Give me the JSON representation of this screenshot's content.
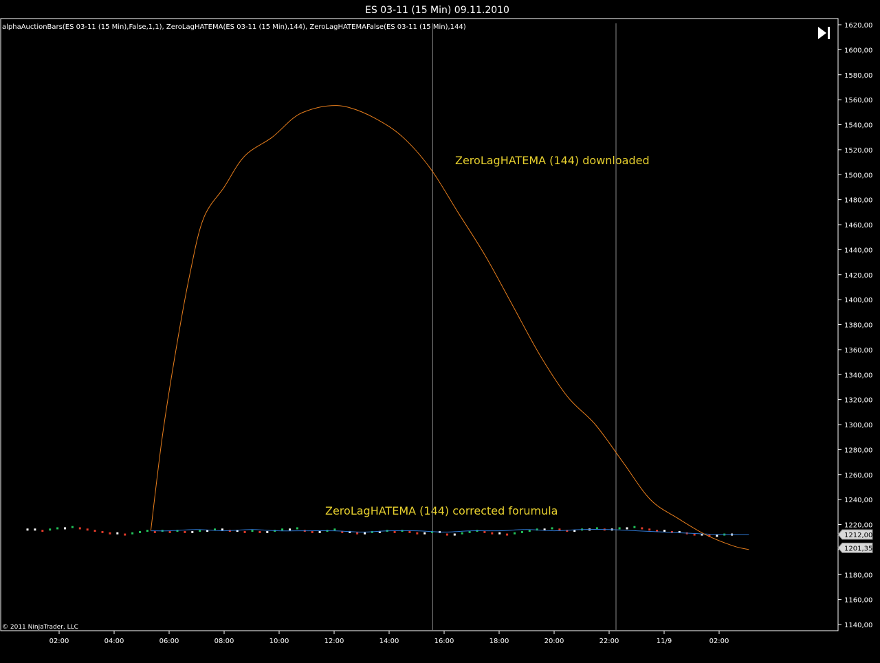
{
  "window": {
    "title": "ES 03-11 (15 Min)  09.11.2010"
  },
  "legend": "alphaAuctionBars(ES 03-11 (15 Min),False,1,1),  ZeroLagHATEMA(ES 03-11 (15 Min),144),  ZeroLagHATEMAFalse(ES 03-11 (15 Min),144)",
  "copyright": "© 2011 NinjaTrader, LLC",
  "colors": {
    "background": "#000000",
    "axis": "#ffffff",
    "orange_line": "#e87e1c",
    "blue_line": "#2f7ad6",
    "up_bar": "#22c35a",
    "down_bar": "#e03a2a",
    "annotation": "#e6cf2e",
    "session_line": "#8a8a8a"
  },
  "icons": {
    "forward_button": "skip-to-end-icon"
  },
  "chart_data": {
    "type": "line",
    "title": "ES 03-11 (15 Min)  09.11.2010",
    "x_ticks": [
      "02:00",
      "04:00",
      "06:00",
      "08:00",
      "10:00",
      "12:00",
      "14:00",
      "16:00",
      "18:00",
      "20:00",
      "22:00",
      "11/9",
      "02:00"
    ],
    "y_ticks": [
      "1140,00",
      "1160,00",
      "1180,00",
      "1200,00",
      "1220,00",
      "1240,00",
      "1260,00",
      "1280,00",
      "1300,00",
      "1320,00",
      "1340,00",
      "1360,00",
      "1380,00",
      "1400,00",
      "1420,00",
      "1440,00",
      "1460,00",
      "1480,00",
      "1500,00",
      "1520,00",
      "1540,00",
      "1560,00",
      "1580,00",
      "1600,00",
      "1620,00"
    ],
    "ylim": [
      1135,
      1635
    ],
    "time_range": [
      "00:30",
      "03:05 (11/9)"
    ],
    "session_breaks": [
      "15:35",
      "22:15"
    ],
    "annotations": [
      {
        "text": "ZeroLagHATEMA (144) downloaded"
      },
      {
        "text": "ZeroLagHATEMA (144) corrected forumula"
      }
    ],
    "price_markers": [
      {
        "label": "1212,00",
        "value": 1212.0
      },
      {
        "label": "1201,35",
        "value": 1201.35
      }
    ],
    "series": [
      {
        "name": "ZeroLagHATEMA(ES 03-11 (15 Min),144)",
        "color": "#e87e1c",
        "points": [
          [
            "05:20",
            1215
          ],
          [
            "05:45",
            1290
          ],
          [
            "06:15",
            1360
          ],
          [
            "06:45",
            1420
          ],
          [
            "07:15",
            1465
          ],
          [
            "08:00",
            1490
          ],
          [
            "08:45",
            1515
          ],
          [
            "09:45",
            1530
          ],
          [
            "10:30",
            1545
          ],
          [
            "11:00",
            1551
          ],
          [
            "11:45",
            1555
          ],
          [
            "12:30",
            1554
          ],
          [
            "13:30",
            1545
          ],
          [
            "14:30",
            1530
          ],
          [
            "15:30",
            1505
          ],
          [
            "16:30",
            1470
          ],
          [
            "17:30",
            1435
          ],
          [
            "18:30",
            1395
          ],
          [
            "19:30",
            1355
          ],
          [
            "20:30",
            1322
          ],
          [
            "21:30",
            1300
          ],
          [
            "22:30",
            1270
          ],
          [
            "23:30",
            1240
          ],
          [
            "00:30",
            1225
          ],
          [
            "01:30",
            1212
          ],
          [
            "02:30",
            1203
          ],
          [
            "03:05",
            1200
          ]
        ]
      },
      {
        "name": "ZeroLagHATEMAFalse(ES 03-11 (15 Min),144)",
        "color": "#2f7ad6",
        "points": [
          [
            "05:20",
            1215
          ],
          [
            "06:00",
            1215
          ],
          [
            "07:00",
            1216
          ],
          [
            "08:00",
            1215
          ],
          [
            "09:00",
            1216
          ],
          [
            "10:00",
            1215
          ],
          [
            "11:00",
            1215
          ],
          [
            "12:00",
            1215
          ],
          [
            "13:00",
            1214
          ],
          [
            "14:00",
            1215
          ],
          [
            "15:00",
            1215
          ],
          [
            "16:00",
            1214
          ],
          [
            "17:00",
            1215
          ],
          [
            "18:00",
            1215
          ],
          [
            "19:00",
            1216
          ],
          [
            "20:00",
            1215
          ],
          [
            "21:00",
            1216
          ],
          [
            "22:00",
            1216
          ],
          [
            "23:00",
            1215
          ],
          [
            "00:00",
            1214
          ],
          [
            "01:00",
            1213
          ],
          [
            "02:00",
            1212
          ],
          [
            "03:05",
            1212
          ]
        ]
      },
      {
        "name": "alphaAuctionBars(ES 03-11 (15 Min),False,1,1)",
        "type": "bars",
        "close": [
          1216,
          1216,
          1215,
          1216,
          1217,
          1217,
          1218,
          1217,
          1216,
          1215,
          1214,
          1213,
          1213,
          1212,
          1213,
          1214,
          1215,
          1214,
          1215,
          1214,
          1215,
          1214,
          1214,
          1215,
          1215,
          1216,
          1216,
          1215,
          1215,
          1214,
          1215,
          1214,
          1214,
          1215,
          1216,
          1216,
          1217,
          1215,
          1214,
          1214,
          1215,
          1216,
          1214,
          1214,
          1213,
          1213,
          1214,
          1214,
          1215,
          1214,
          1215,
          1214,
          1213,
          1213,
          1214,
          1214,
          1212,
          1212,
          1213,
          1214,
          1215,
          1214,
          1213,
          1213,
          1212,
          1213,
          1214,
          1215,
          1216,
          1216,
          1217,
          1216,
          1215,
          1215,
          1216,
          1216,
          1217,
          1216,
          1216,
          1217,
          1217,
          1218,
          1217,
          1216,
          1215,
          1215,
          1214,
          1214,
          1213,
          1212,
          1212,
          1211,
          1211,
          1212,
          1212,
          1212
        ]
      }
    ]
  }
}
